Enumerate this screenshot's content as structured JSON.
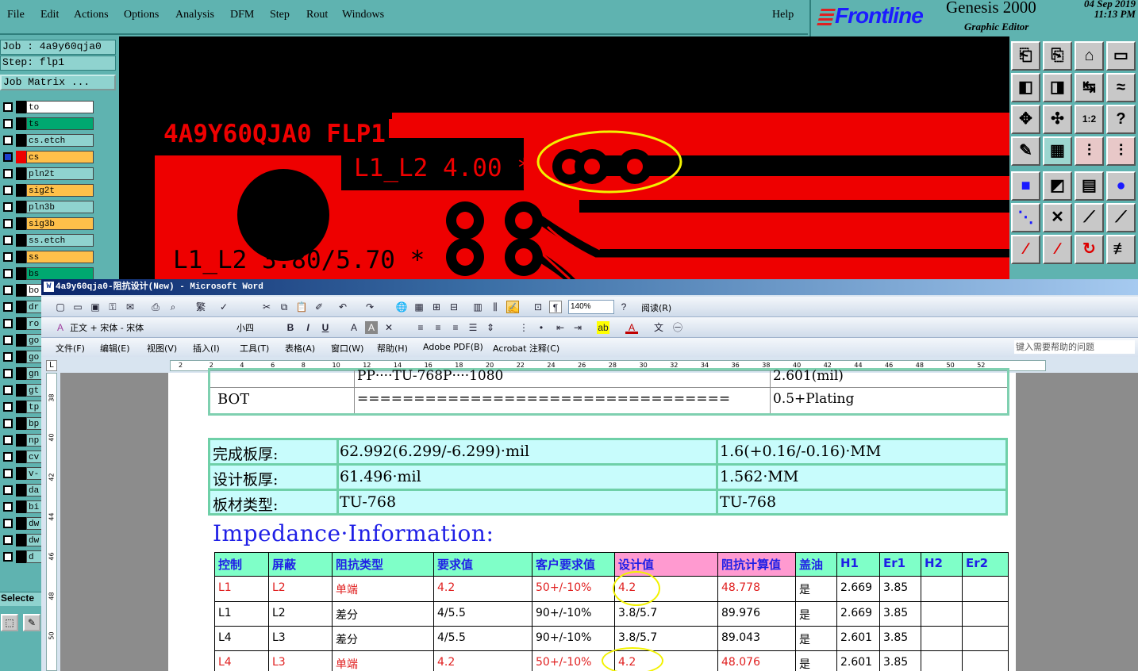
{
  "genesis": {
    "menu": [
      "File",
      "Edit",
      "Actions",
      "Options",
      "Analysis",
      "DFM",
      "Step",
      "Rout",
      "Windows"
    ],
    "help": "Help",
    "brand": {
      "logo": "Frontline",
      "product": "Genesis 2000",
      "subtitle": "Graphic Editor",
      "date": "04 Sep 2019",
      "time": "11:13 PM"
    },
    "job": "Job : 4a9y60qja0",
    "step": "Step: flp1",
    "job_matrix": "Job Matrix ...",
    "layers": [
      {
        "name": "to",
        "color": "#ffffff",
        "checked": false
      },
      {
        "name": "ts",
        "color": "#00a870",
        "checked": false
      },
      {
        "name": "cs.etch",
        "color": "#8fd3cf",
        "checked": false
      },
      {
        "name": "cs",
        "color": "#ffc04a",
        "checked": true
      },
      {
        "name": "pln2t",
        "color": "#8fd3cf",
        "checked": false
      },
      {
        "name": "sig2t",
        "color": "#ffc04a",
        "checked": false
      },
      {
        "name": "pln3b",
        "color": "#8fd3cf",
        "checked": false
      },
      {
        "name": "sig3b",
        "color": "#ffc04a",
        "checked": false
      },
      {
        "name": "ss.etch",
        "color": "#8fd3cf",
        "checked": false
      },
      {
        "name": "ss",
        "color": "#ffc04a",
        "checked": false
      },
      {
        "name": "bs",
        "color": "#00a870",
        "checked": false
      },
      {
        "name": "bo",
        "color": "#ffffff",
        "checked": false
      },
      {
        "name": "dr",
        "color": "#8fd3cf",
        "checked": false
      },
      {
        "name": "ro",
        "color": "#8fd3cf",
        "checked": false
      },
      {
        "name": "go",
        "color": "#8fd3cf",
        "checked": false
      },
      {
        "name": "go",
        "color": "#8fd3cf",
        "checked": false
      },
      {
        "name": "gn",
        "color": "#8fd3cf",
        "checked": false
      },
      {
        "name": "gt",
        "color": "#8fd3cf",
        "checked": false
      },
      {
        "name": "tp",
        "color": "#8fd3cf",
        "checked": false
      },
      {
        "name": "bp",
        "color": "#8fd3cf",
        "checked": false
      },
      {
        "name": "np",
        "color": "#8fd3cf",
        "checked": false
      },
      {
        "name": "cv",
        "color": "#8fd3cf",
        "checked": false
      },
      {
        "name": "v-",
        "color": "#8fd3cf",
        "checked": false
      },
      {
        "name": "da",
        "color": "#8fd3cf",
        "checked": false
      },
      {
        "name": "bi",
        "color": "#8fd3cf",
        "checked": false
      },
      {
        "name": "dw",
        "color": "#8fd3cf",
        "checked": false
      },
      {
        "name": "dw",
        "color": "#8fd3cf",
        "checked": false
      },
      {
        "name": "d",
        "color": "#8fd3cf",
        "checked": false
      }
    ],
    "selecte": "Selecte",
    "canvas": {
      "board_label": "4A9Y60QJA0 FLP1",
      "label_se": "L1_L2 4.00 *",
      "label_diff": "L1_L2 3.80/5.70 *",
      "fill_color": "#ee0000",
      "background": "#000000"
    }
  },
  "word": {
    "title": "4a9y60qja0-阻抗设计(New) - Microsoft Word",
    "toolbar1": {
      "zoom": "140%",
      "read": "阅读(R)"
    },
    "toolbar2": {
      "style": "正文 + 宋体 - 宋体",
      "size": "小四"
    },
    "menus": [
      "文件(F)",
      "编辑(E)",
      "视图(V)",
      "插入(I)",
      "工具(T)",
      "表格(A)",
      "窗口(W)",
      "帮助(H)",
      "Adobe PDF(B)",
      "Acrobat 注释(C)"
    ],
    "help_placeholder": "键入需要帮助的问题",
    "ruler": [
      "2",
      "2",
      "4",
      "6",
      "8",
      "10",
      "12",
      "14",
      "16",
      "18",
      "20",
      "22",
      "24",
      "26",
      "28",
      "30",
      "32",
      "34",
      "36",
      "38",
      "40",
      "42",
      "44",
      "46",
      "48",
      "50",
      "52"
    ],
    "vruler": [
      "38",
      "40",
      "42",
      "44",
      "46",
      "48",
      "50"
    ],
    "stack_rows": [
      {
        "layer": "",
        "material": "PP····TU-768P····1080",
        "thickness": "2.601(mil)"
      },
      {
        "layer": "BOT",
        "material": "=================================",
        "thickness": "0.5+Plating"
      }
    ],
    "board_rows": [
      {
        "label": "完成板厚:",
        "mil": "62.992(6.299/-6.299)·mil",
        "mm": "1.6(+0.16/-0.16)·MM"
      },
      {
        "label": "设计板厚:",
        "mil": "61.496·mil",
        "mm": "1.562·MM"
      },
      {
        "label": "板材类型:",
        "mil": "TU-768",
        "mm": "TU-768"
      }
    ],
    "impedance_title": "Impedance·Information:",
    "impedance_headers": [
      "控制",
      "屏蔽",
      "阻抗类型",
      "要求值",
      "客户要求值",
      "设计值",
      "阻抗计算值",
      "盖油",
      "H1",
      "Er1",
      "H2",
      "Er2"
    ],
    "impedance_rows": [
      {
        "control": "L1",
        "shield": "L2",
        "type": "单端",
        "req": "4.2",
        "cust": "50+/-10%",
        "design": "4.2",
        "calc": "48.778",
        "mask": "是",
        "h1": "2.669",
        "er1": "3.85",
        "h2": "",
        "er2": "",
        "highlight": true
      },
      {
        "control": "L1",
        "shield": "L2",
        "type": "差分",
        "req": "4/5.5",
        "cust": "90+/-10%",
        "design": "3.8/5.7",
        "calc": "89.976",
        "mask": "是",
        "h1": "2.669",
        "er1": "3.85",
        "h2": "",
        "er2": "",
        "highlight": false
      },
      {
        "control": "L4",
        "shield": "L3",
        "type": "差分",
        "req": "4/5.5",
        "cust": "90+/-10%",
        "design": "3.8/5.7",
        "calc": "89.043",
        "mask": "是",
        "h1": "2.601",
        "er1": "3.85",
        "h2": "",
        "er2": "",
        "highlight": false
      },
      {
        "control": "L4",
        "shield": "L3",
        "type": "单端",
        "req": "4.2",
        "cust": "50+/-10%",
        "design": "4.2",
        "calc": "48.076",
        "mask": "是",
        "h1": "2.601",
        "er1": "3.85",
        "h2": "",
        "er2": "",
        "highlight": true
      }
    ]
  }
}
